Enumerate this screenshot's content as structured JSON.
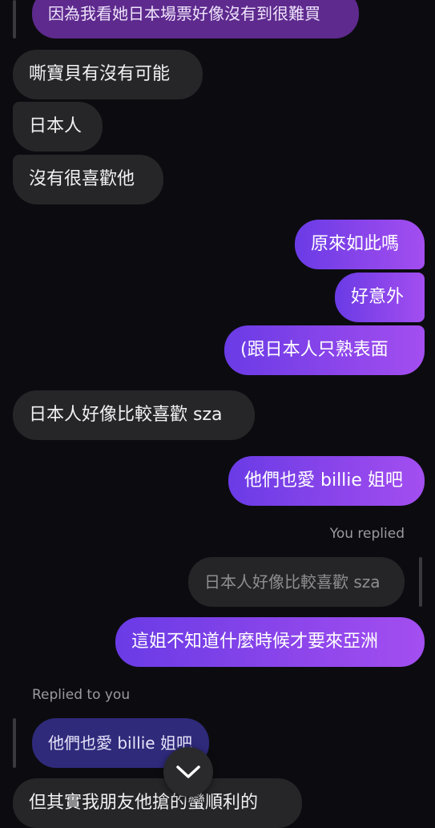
{
  "messages": {
    "top_quote": "因為我看她日本場票好像沒有到很難買",
    "m1": "嘶寶貝有沒有可能",
    "m2": "日本人",
    "m3": "沒有很喜歡他",
    "m4": "原來如此嗎",
    "m5": "好意外",
    "m6": "(跟日本人只熟表面",
    "m7": "日本人好像比較喜歡 sza",
    "m8": "他們也愛 billie 姐吧",
    "reply_meta_out": "You replied",
    "reply_quote_out": "日本人好像比較喜歡 sza",
    "m9": "這姐不知道什麼時候才要來亞洲",
    "reply_meta_in": "Replied to you",
    "reply_quote_in": "他們也愛 billie 姐吧",
    "m10": "但其實我朋友他搶的蠻順利的"
  },
  "colors": {
    "background": "#0c0c10",
    "incoming_bubble": "#262629",
    "outgoing_start": "#6a3be6",
    "outgoing_end": "#a34ef0"
  },
  "icons": {
    "scroll_down": "chevron-down-icon"
  }
}
